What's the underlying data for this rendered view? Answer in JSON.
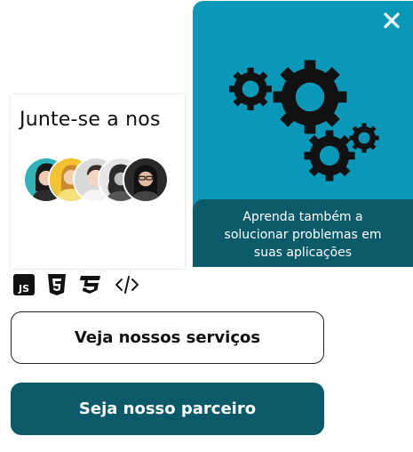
{
  "join_card": {
    "title": "Junte-se a nos"
  },
  "promo": {
    "caption_lines": [
      "Aprenda também a",
      "solucionar problemas em",
      "suas aplicações"
    ],
    "close_icon": "close-icon",
    "illustration_icon": "gears-icon"
  },
  "tech_icons": [
    "javascript-icon",
    "html5-icon",
    "css3-icon",
    "code-icon"
  ],
  "buttons": {
    "services_label": "Veja nossos serviços",
    "partner_label": "Seja nosso parceiro"
  },
  "colors": {
    "promo_background": "#0a98b8",
    "dark_teal": "#0a5a6a"
  }
}
